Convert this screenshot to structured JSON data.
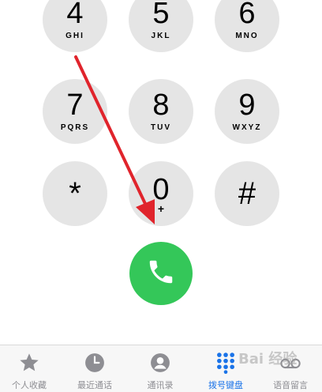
{
  "keypad": {
    "k4": {
      "digit": "4",
      "letters": "GHI"
    },
    "k5": {
      "digit": "5",
      "letters": "JKL"
    },
    "k6": {
      "digit": "6",
      "letters": "MNO"
    },
    "k7": {
      "digit": "7",
      "letters": "PQRS"
    },
    "k8": {
      "digit": "8",
      "letters": "TUV"
    },
    "k9": {
      "digit": "9",
      "letters": "WXYZ"
    },
    "star": {
      "digit": "*"
    },
    "k0": {
      "digit": "0",
      "letters": "+"
    },
    "hash": {
      "digit": "#"
    }
  },
  "call_button": {
    "icon": "phone-icon",
    "color": "#34c759"
  },
  "annotation": {
    "color": "#e0242c"
  },
  "tabs": [
    {
      "label": "个人收藏",
      "icon": "star-icon"
    },
    {
      "label": "最近通话",
      "icon": "clock-icon"
    },
    {
      "label": "通讯录",
      "icon": "contact-icon"
    },
    {
      "label": "拨号键盘",
      "icon": "keypad-icon",
      "active": true
    },
    {
      "label": "语音留言",
      "icon": "voicemail-icon"
    }
  ],
  "accent_color": "#1a73e8",
  "watermark": "Bai 经验"
}
